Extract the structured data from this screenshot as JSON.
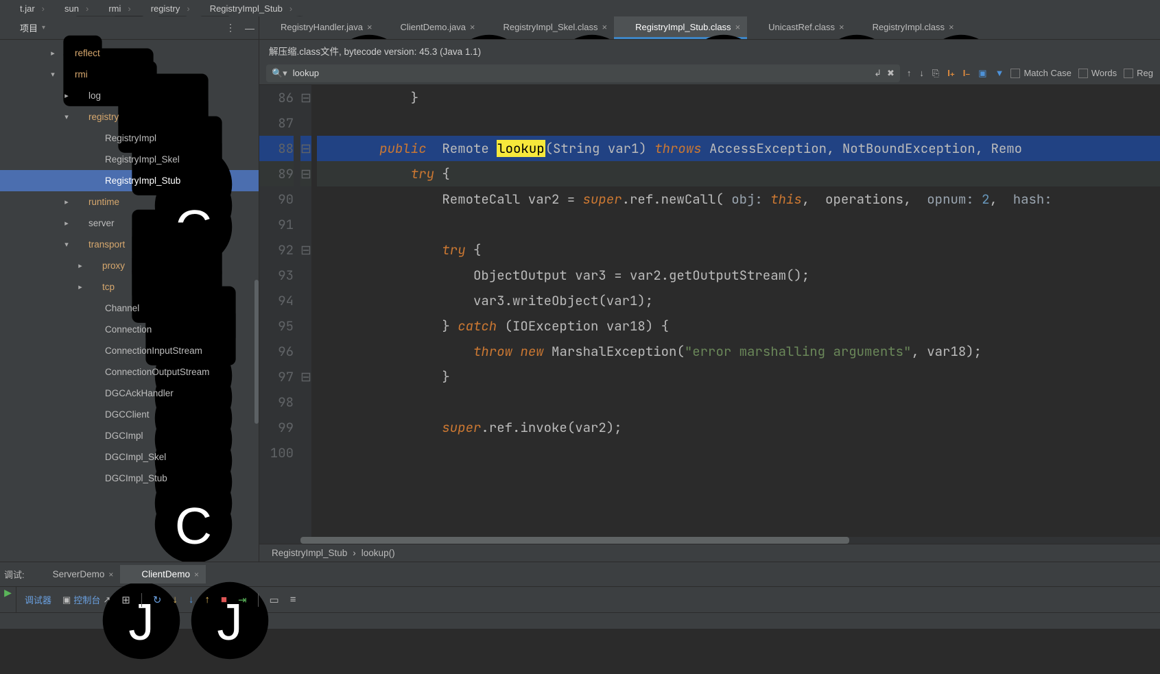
{
  "breadcrumbs": [
    {
      "icon": "jar",
      "label": "t.jar"
    },
    {
      "icon": "folder",
      "label": "sun"
    },
    {
      "icon": "folder",
      "label": "rmi"
    },
    {
      "icon": "folder",
      "label": "registry"
    },
    {
      "icon": "class",
      "label": "RegistryImpl_Stub"
    }
  ],
  "sidebar": {
    "project_label": "项目",
    "tree": [
      {
        "indent": 72,
        "chev": ">",
        "icon": "folder",
        "name": "reflect",
        "orange": true
      },
      {
        "indent": 72,
        "chev": "v",
        "icon": "folder",
        "name": "rmi",
        "orange": true
      },
      {
        "indent": 92,
        "chev": ">",
        "icon": "folder",
        "name": "log",
        "orange": false
      },
      {
        "indent": 92,
        "chev": "v",
        "icon": "folder",
        "name": "registry",
        "orange": true
      },
      {
        "indent": 116,
        "chev": "",
        "icon": "class",
        "name": "RegistryImpl",
        "orange": false
      },
      {
        "indent": 116,
        "chev": "",
        "icon": "class",
        "name": "RegistryImpl_Skel",
        "orange": false
      },
      {
        "indent": 116,
        "chev": "",
        "icon": "class",
        "name": "RegistryImpl_Stub",
        "orange": false,
        "selected": true
      },
      {
        "indent": 92,
        "chev": ">",
        "icon": "folder",
        "name": "runtime",
        "orange": true
      },
      {
        "indent": 92,
        "chev": ">",
        "icon": "folder",
        "name": "server",
        "orange": false
      },
      {
        "indent": 92,
        "chev": "v",
        "icon": "folder",
        "name": "transport",
        "orange": true
      },
      {
        "indent": 112,
        "chev": ">",
        "icon": "folder",
        "name": "proxy",
        "orange": true
      },
      {
        "indent": 112,
        "chev": ">",
        "icon": "folder",
        "name": "tcp",
        "orange": true
      },
      {
        "indent": 116,
        "chev": "",
        "icon": "class",
        "name": "Channel",
        "orange": false
      },
      {
        "indent": 116,
        "chev": "",
        "icon": "class",
        "name": "Connection",
        "orange": false
      },
      {
        "indent": 116,
        "chev": "",
        "icon": "class",
        "name": "ConnectionInputStream",
        "orange": false
      },
      {
        "indent": 116,
        "chev": "",
        "icon": "class",
        "name": "ConnectionOutputStream",
        "orange": false
      },
      {
        "indent": 116,
        "chev": "",
        "icon": "class",
        "name": "DGCAckHandler",
        "orange": false
      },
      {
        "indent": 116,
        "chev": "",
        "icon": "class",
        "name": "DGCClient",
        "orange": false
      },
      {
        "indent": 116,
        "chev": "",
        "icon": "class",
        "name": "DGCImpl",
        "orange": false
      },
      {
        "indent": 116,
        "chev": "",
        "icon": "class",
        "name": "DGCImpl_Skel",
        "orange": false
      },
      {
        "indent": 116,
        "chev": "",
        "icon": "class",
        "name": "DGCImpl_Stub",
        "orange": false
      }
    ]
  },
  "tabs": [
    {
      "icon": "java",
      "label": "RegistryHandler.java",
      "active": false
    },
    {
      "icon": "java",
      "label": "ClientDemo.java",
      "active": false
    },
    {
      "icon": "class",
      "label": "RegistryImpl_Skel.class",
      "active": false
    },
    {
      "icon": "class",
      "label": "RegistryImpl_Stub.class",
      "active": true
    },
    {
      "icon": "class",
      "label": "UnicastRef.class",
      "active": false
    },
    {
      "icon": "class",
      "label": "RegistryImpl.class",
      "active": false
    }
  ],
  "banner": {
    "text": "解压缩.class文件, bytecode version: 45.3 (Java 1.1)"
  },
  "search": {
    "value": "lookup",
    "match_case": "Match Case",
    "words": "Words",
    "regex": "Reg"
  },
  "code": {
    "lines": [
      {
        "n": 86,
        "type": "plain",
        "tok": [
          {
            "t": "            }",
            "c": ""
          }
        ],
        "fold": "└"
      },
      {
        "n": 87,
        "type": "plain",
        "tok": [
          {
            "t": "",
            "c": ""
          }
        ]
      },
      {
        "n": 88,
        "type": "hl",
        "tok": [
          {
            "t": "        ",
            "c": ""
          },
          {
            "t": "public",
            "c": "kw"
          },
          {
            "t": "  Remote ",
            "c": ""
          },
          {
            "t": "lookup",
            "c": "hlmatch"
          },
          {
            "t": "(String var1) ",
            "c": ""
          },
          {
            "t": "throws",
            "c": "kw"
          },
          {
            "t": " AccessException, NotBoundException, Remo",
            "c": ""
          }
        ],
        "fold": "┌"
      },
      {
        "n": 89,
        "type": "curr",
        "tok": [
          {
            "t": "            ",
            "c": ""
          },
          {
            "t": "try",
            "c": "kw"
          },
          {
            "t": " {",
            "c": ""
          }
        ],
        "fold": "┌"
      },
      {
        "n": 90,
        "type": "plain",
        "tok": [
          {
            "t": "                RemoteCall var2 = ",
            "c": ""
          },
          {
            "t": "super",
            "c": "kw"
          },
          {
            "t": ".ref.newCall( ",
            "c": ""
          },
          {
            "t": "obj:",
            "c": "param"
          },
          {
            "t": " ",
            "c": ""
          },
          {
            "t": "this",
            "c": "self"
          },
          {
            "t": ",  operations,  ",
            "c": ""
          },
          {
            "t": "opnum:",
            "c": "param"
          },
          {
            "t": " ",
            "c": ""
          },
          {
            "t": "2",
            "c": "num"
          },
          {
            "t": ",  ",
            "c": ""
          },
          {
            "t": "hash:",
            "c": "param"
          }
        ]
      },
      {
        "n": 91,
        "type": "plain",
        "tok": [
          {
            "t": "",
            "c": ""
          }
        ]
      },
      {
        "n": 92,
        "type": "plain",
        "tok": [
          {
            "t": "                ",
            "c": ""
          },
          {
            "t": "try",
            "c": "kw"
          },
          {
            "t": " {",
            "c": ""
          }
        ],
        "fold": "┌"
      },
      {
        "n": 93,
        "type": "plain",
        "tok": [
          {
            "t": "                    ObjectOutput var3 = var2.getOutputStream();",
            "c": ""
          }
        ]
      },
      {
        "n": 94,
        "type": "plain",
        "tok": [
          {
            "t": "                    var3.writeObject(var1);",
            "c": ""
          }
        ]
      },
      {
        "n": 95,
        "type": "plain",
        "tok": [
          {
            "t": "                } ",
            "c": ""
          },
          {
            "t": "catch",
            "c": "kw"
          },
          {
            "t": " (IOException var18) {",
            "c": ""
          }
        ]
      },
      {
        "n": 96,
        "type": "plain",
        "tok": [
          {
            "t": "                    ",
            "c": ""
          },
          {
            "t": "throw",
            "c": "kw"
          },
          {
            "t": " ",
            "c": ""
          },
          {
            "t": "new",
            "c": "kw"
          },
          {
            "t": " MarshalException(",
            "c": ""
          },
          {
            "t": "\"error marshalling arguments\"",
            "c": "str"
          },
          {
            "t": ", var18);",
            "c": ""
          }
        ]
      },
      {
        "n": 97,
        "type": "plain",
        "tok": [
          {
            "t": "                }",
            "c": ""
          }
        ],
        "fold": "└"
      },
      {
        "n": 98,
        "type": "plain",
        "tok": [
          {
            "t": "",
            "c": ""
          }
        ]
      },
      {
        "n": 99,
        "type": "plain",
        "tok": [
          {
            "t": "                ",
            "c": ""
          },
          {
            "t": "super",
            "c": "kw"
          },
          {
            "t": ".ref.invoke(var2);",
            "c": ""
          }
        ]
      },
      {
        "n": 100,
        "type": "plain",
        "tok": [
          {
            "t": "",
            "c": ""
          }
        ]
      }
    ],
    "editor_crumb": [
      "RegistryImpl_Stub",
      "›",
      "lookup()"
    ]
  },
  "debug": {
    "label": "调试:",
    "tabs": [
      {
        "name": "ServerDemo",
        "icon": "java",
        "active": false
      },
      {
        "name": "ClientDemo",
        "icon": "java",
        "active": true
      }
    ],
    "toolbar": {
      "sub1": "调试器",
      "sub2": "控制台"
    }
  }
}
